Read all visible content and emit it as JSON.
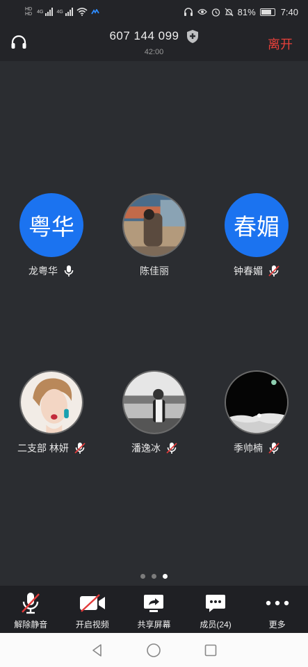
{
  "status_bar": {
    "network_left_1": "HD",
    "network_left_2": "HD",
    "net_type_1": "4G",
    "net_type_2": "4G",
    "battery_percent": "81%",
    "battery_level": 0.81,
    "time": "7:40"
  },
  "header": {
    "meeting_id": "607 144 099",
    "elapsed_time": "42:00",
    "leave_label": "离开"
  },
  "participants": [
    {
      "name": "龙粤华",
      "avatar_text": "粤华",
      "avatar_type": "initials",
      "mic": "on"
    },
    {
      "name": "陈佳丽",
      "avatar_text": "",
      "avatar_type": "photo",
      "mic": "none"
    },
    {
      "name": "钟春媚",
      "avatar_text": "春媚",
      "avatar_type": "initials",
      "mic": "muted"
    },
    {
      "name": "二支部 林妍",
      "avatar_text": "",
      "avatar_type": "photo",
      "mic": "muted"
    },
    {
      "name": "潘逸冰",
      "avatar_text": "",
      "avatar_type": "photo",
      "mic": "muted"
    },
    {
      "name": "季帅楠",
      "avatar_text": "",
      "avatar_type": "photo",
      "mic": "muted"
    }
  ],
  "pager": {
    "pages": 3,
    "active": 3
  },
  "toolbar": {
    "unmute_label": "解除静音",
    "start_video_label": "开启视频",
    "share_screen_label": "共享屏幕",
    "members_label": "成员(24)",
    "more_label": "更多"
  },
  "colors": {
    "background": "#2b2d31",
    "bar": "#232428",
    "accent_blue": "#1b73f0",
    "leave_red": "#e8403a",
    "muted_red": "#e23a3a"
  }
}
